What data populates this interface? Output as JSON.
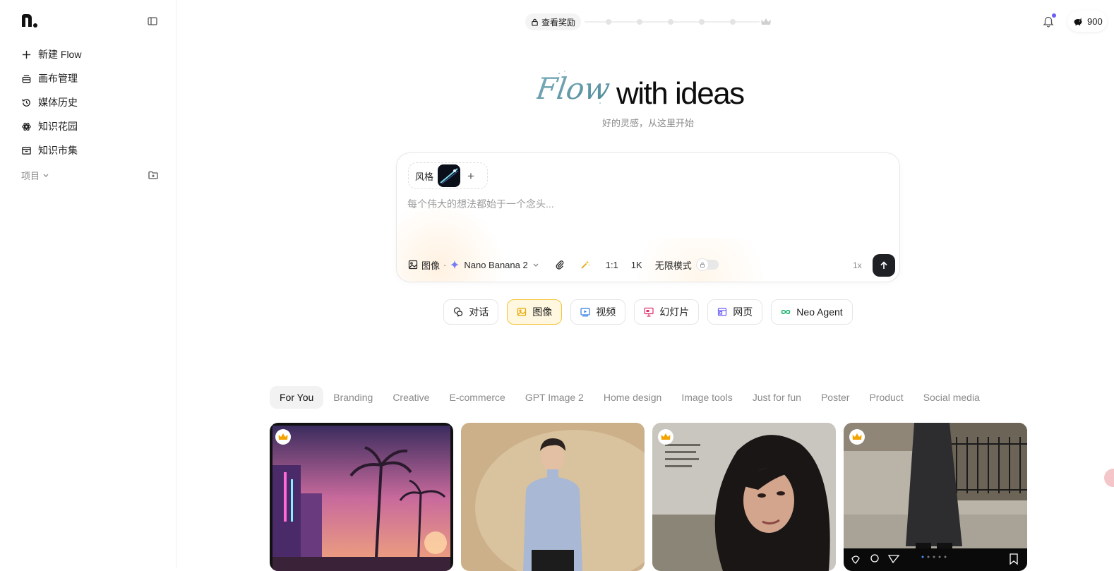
{
  "sidebar": {
    "items": [
      {
        "icon": "plus-icon",
        "label": "新建 Flow"
      },
      {
        "icon": "canvas-icon",
        "label": "画布管理"
      },
      {
        "icon": "history-icon",
        "label": "媒体历史"
      },
      {
        "icon": "garden-icon",
        "label": "知识花园"
      },
      {
        "icon": "market-icon",
        "label": "知识市集"
      }
    ],
    "projects_label": "项目"
  },
  "topbar": {
    "rewards_label": "查看奖励",
    "credits": "900"
  },
  "hero": {
    "script_word": "Flow",
    "title": "with ideas",
    "subtitle": "好的灵感，从这里开始"
  },
  "composer": {
    "style_label": "风格",
    "placeholder": "每个伟大的想法都始于一个念头...",
    "mode": "图像",
    "model": "Nano Banana 2",
    "ratio": "1:1",
    "resolution": "1K",
    "unlimited_label": "无限模式",
    "count": "1x"
  },
  "modes": [
    {
      "icon": "chat-icon",
      "label": "对话",
      "active": false
    },
    {
      "icon": "image-icon",
      "label": "图像",
      "active": true
    },
    {
      "icon": "video-icon",
      "label": "视频",
      "active": false
    },
    {
      "icon": "slides-icon",
      "label": "幻灯片",
      "active": false
    },
    {
      "icon": "webpage-icon",
      "label": "网页",
      "active": false
    },
    {
      "icon": "infinity-icon",
      "label": "Neo Agent",
      "active": false
    }
  ],
  "categories": [
    "For You",
    "Branding",
    "Creative",
    "E-commerce",
    "GPT Image 2",
    "Home design",
    "Image tools",
    "Just for fun",
    "Poster",
    "Product",
    "Social media"
  ],
  "gallery": [
    {
      "premium": true,
      "subject": "neon beach street at sunset"
    },
    {
      "premium": false,
      "subject": "man in blue turtleneck"
    },
    {
      "premium": true,
      "subject": "film poster portrait"
    },
    {
      "premium": true,
      "subject": "street fashion long coat"
    }
  ],
  "colors": {
    "accent_active": "#f5c33b",
    "send_button": "#1f2024",
    "notification_dot": "#6b5cf6"
  }
}
